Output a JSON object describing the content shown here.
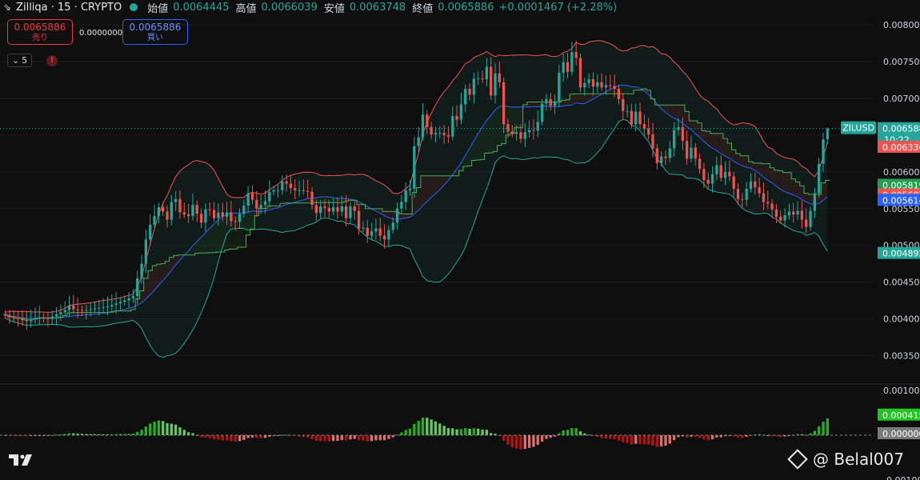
{
  "header": {
    "logo_icon": "tradingview-symbol-icon",
    "title": "Zilliqa · 15 · CRYPTO",
    "ohlc": {
      "open_label": "始値",
      "open_value": "0.0064445",
      "high_label": "高値",
      "high_value": "0.0066039",
      "low_label": "安値",
      "low_value": "0.0063748",
      "close_label": "終値",
      "close_value": "0.0065886",
      "change": "+0.0001467 (+2.28%)"
    }
  },
  "trade": {
    "sell_price": "0.0065886",
    "sell_label": "売り",
    "spread": "0.0000000",
    "buy_price": "0.0065886",
    "buy_label": "買い"
  },
  "indicator_toggle": {
    "icon": "chevron-down-icon",
    "count": "5"
  },
  "alert_icon": "!",
  "watermark": {
    "handle": "@ Belal007",
    "icon": "binance-square-icon"
  },
  "colors": {
    "up": "#26a69a",
    "down": "#ef5350",
    "bb_upper": "#f05454",
    "bb_lower": "#26a69a",
    "bb_mid": "#2962ff",
    "macd_pos": "#22b022",
    "macd_neg": "#b21414"
  },
  "chart_data": [
    {
      "type": "candlestick",
      "title": "Zilliqa · 15 · CRYPTO",
      "symbol_tag": "ZILUSD",
      "countdown": "10:22",
      "ylim": [
        0.0032,
        0.0081
      ],
      "yticks": [
        "0.0080000",
        "0.0075000",
        "0.0070000",
        "0.0065000",
        "0.0060000",
        "0.0055000",
        "0.0050000",
        "0.0045000",
        "0.0040000",
        "0.0035000"
      ],
      "price_labels": [
        {
          "value": "0.0065886",
          "color": "#26a69a"
        },
        {
          "value": "0.0063360",
          "color": "#ef5350"
        },
        {
          "value": "0.0058190",
          "color": "#22a052"
        },
        {
          "value": "0.0056870",
          "color": "#ef5350"
        },
        {
          "value": "0.0056140",
          "color": "#2962ff"
        },
        {
          "value": "0.0048920",
          "color": "#26a69a"
        }
      ],
      "closes": [
        0.00405,
        0.00403,
        0.00401,
        0.004,
        0.00398,
        0.00397,
        0.00399,
        0.00401,
        0.00402,
        0.00401,
        0.004,
        0.00403,
        0.00406,
        0.00409,
        0.00412,
        0.00418,
        0.00413,
        0.00412,
        0.00411,
        0.00412,
        0.00413,
        0.00414,
        0.00415,
        0.00416,
        0.00417,
        0.00419,
        0.00421,
        0.00423,
        0.00425,
        0.00428,
        0.00431,
        0.00455,
        0.00475,
        0.00508,
        0.00528,
        0.0054,
        0.00552,
        0.00546,
        0.00535,
        0.00559,
        0.00563,
        0.00545,
        0.00542,
        0.0054,
        0.00555,
        0.00543,
        0.00531,
        0.00549,
        0.00548,
        0.00537,
        0.00545,
        0.00539,
        0.00545,
        0.00533,
        0.00532,
        0.00543,
        0.00554,
        0.00571,
        0.00562,
        0.0055,
        0.00555,
        0.0056,
        0.00573,
        0.00575,
        0.00575,
        0.00587,
        0.00584,
        0.00578,
        0.00575,
        0.00575,
        0.00574,
        0.00573,
        0.00555,
        0.00544,
        0.00553,
        0.00551,
        0.00546,
        0.00552,
        0.00546,
        0.00553,
        0.00537,
        0.00553,
        0.00547,
        0.00523,
        0.00524,
        0.00513,
        0.00519,
        0.00523,
        0.00513,
        0.00508,
        0.00521,
        0.00531,
        0.0055,
        0.00559,
        0.00575,
        0.00577,
        0.00635,
        0.00647,
        0.00678,
        0.00661,
        0.00651,
        0.00653,
        0.00653,
        0.0065,
        0.00648,
        0.00676,
        0.00671,
        0.00692,
        0.00713,
        0.00705,
        0.00727,
        0.00727,
        0.00726,
        0.00743,
        0.00704,
        0.00734,
        0.00722,
        0.00665,
        0.00655,
        0.00652,
        0.00654,
        0.00645,
        0.00654,
        0.00657,
        0.00656,
        0.00668,
        0.00693,
        0.00699,
        0.0069,
        0.00696,
        0.00735,
        0.00749,
        0.00736,
        0.00763,
        0.00755,
        0.00715,
        0.00721,
        0.00726,
        0.00716,
        0.00722,
        0.00715,
        0.00718,
        0.00717,
        0.00713,
        0.00699,
        0.00683,
        0.00683,
        0.00665,
        0.00682,
        0.00665,
        0.00659,
        0.00651,
        0.00632,
        0.00612,
        0.00621,
        0.00619,
        0.00632,
        0.00657,
        0.00661,
        0.00642,
        0.00618,
        0.00633,
        0.00618,
        0.00604,
        0.00589,
        0.00584,
        0.00597,
        0.00609,
        0.00592,
        0.006,
        0.00594,
        0.00577,
        0.00563,
        0.00562,
        0.00577,
        0.00587,
        0.00579,
        0.00571,
        0.00559,
        0.00557,
        0.00549,
        0.00539,
        0.00534,
        0.00541,
        0.00546,
        0.00542,
        0.00547,
        0.00535,
        0.00525,
        0.00547,
        0.00571,
        0.00611,
        0.00644,
        0.00659
      ]
    },
    {
      "type": "bar",
      "title": "MACD histogram",
      "ylim": [
        -0.001,
        0.001
      ],
      "yticks": [
        "0.0010000",
        "0.0000000",
        "-0.0010000"
      ],
      "value_labels": [
        {
          "value": "0.0004150",
          "color": "#22c522"
        },
        {
          "value": "0.0000000",
          "color": "#7a7a7a"
        }
      ],
      "values": [
        0,
        0,
        0,
        0,
        0,
        0,
        0,
        0,
        0,
        0,
        0,
        0,
        0,
        0,
        0,
        0,
        0,
        0,
        0,
        0,
        0,
        0,
        0,
        0,
        0,
        0,
        0,
        0,
        0,
        0,
        0,
        0,
        0,
        0,
        0,
        0,
        0,
        0,
        0,
        0,
        0,
        0,
        0,
        0,
        0,
        0,
        0,
        0,
        0,
        0,
        0,
        0,
        0,
        0,
        0,
        0,
        0,
        0,
        0,
        0,
        0,
        0,
        0,
        0,
        0,
        0,
        0,
        0,
        0,
        0,
        0,
        0,
        0,
        0,
        0,
        0,
        0,
        0,
        0,
        0,
        0,
        0,
        0,
        0,
        0,
        0,
        0,
        0,
        0,
        0,
        0,
        0,
        0,
        0,
        0,
        0,
        0,
        0,
        0,
        0,
        0,
        0,
        0,
        0,
        0,
        0,
        0,
        0,
        0,
        0,
        0,
        0,
        0,
        0,
        0,
        0,
        0,
        0,
        0,
        0,
        0,
        0,
        0,
        0,
        0,
        0,
        0,
        0,
        0,
        0,
        0,
        0,
        0,
        0,
        0,
        0,
        0,
        0,
        0,
        0,
        0,
        0,
        0,
        0,
        0,
        0,
        0,
        0,
        0,
        0,
        0,
        0,
        0,
        0,
        0,
        0,
        0,
        0,
        0,
        0,
        0,
        0,
        0,
        0,
        0,
        0,
        0,
        0,
        0,
        0,
        0,
        0,
        0,
        0,
        0,
        0,
        0,
        0,
        0,
        0,
        0,
        0,
        0,
        0,
        0,
        0,
        0,
        0,
        0,
        0,
        0,
        0,
        0,
        0,
        0,
        0,
        0,
        0
      ]
    }
  ]
}
